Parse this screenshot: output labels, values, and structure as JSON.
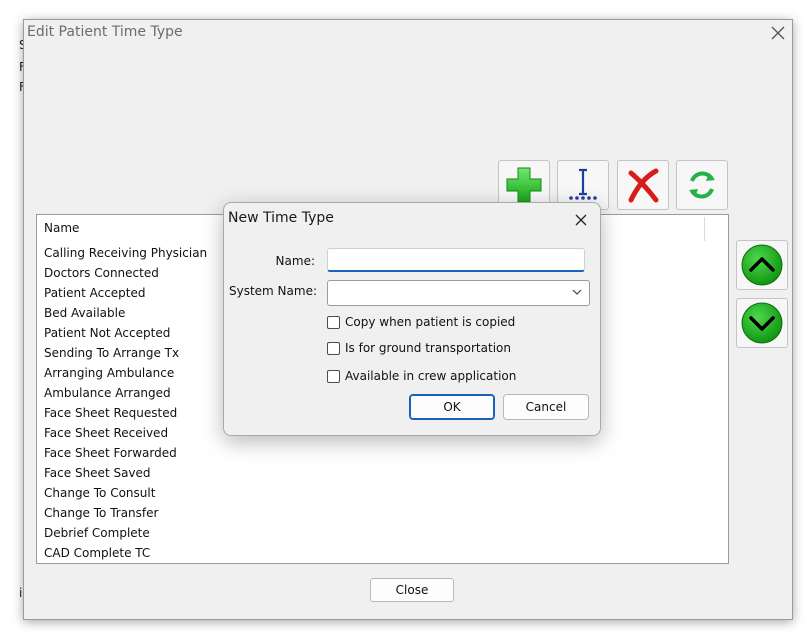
{
  "background": {
    "fragments": [
      "S",
      "F",
      "F",
      "i"
    ]
  },
  "main_window": {
    "title": "Edit Patient Time Type",
    "toolbar": {
      "add_icon": "plus-icon",
      "insert_icon": "insert-icon",
      "delete_icon": "delete-x-icon",
      "refresh_icon": "refresh-icon"
    },
    "list": {
      "header": "Name",
      "items": [
        "Calling Receiving Physician",
        "Doctors Connected",
        "Patient Accepted",
        "Bed Available",
        "Patient Not Accepted",
        "Sending To Arrange Tx",
        "Arranging Ambulance",
        "Ambulance Arranged",
        "Face Sheet Requested",
        "Face Sheet Received",
        "Face Sheet Forwarded",
        "Face Sheet Saved",
        "Change To Consult",
        "Change To Transfer",
        "Debrief Complete",
        "CAD Complete TC"
      ]
    },
    "close_label": "Close"
  },
  "dialog": {
    "title": "New Time Type",
    "name_label": "Name:",
    "name_value": "",
    "system_name_label": "System Name:",
    "system_name_value": "",
    "checkboxes": [
      {
        "label": "Copy when patient is copied",
        "checked": false
      },
      {
        "label": "Is for ground transportation",
        "checked": false
      },
      {
        "label": "Available in crew application",
        "checked": false
      }
    ],
    "ok_label": "OK",
    "cancel_label": "Cancel"
  },
  "colors": {
    "accent": "#1a62b5",
    "add_green": "#2fbf2f",
    "delete_red": "#d81b1b",
    "refresh_green": "#22b24c",
    "arrow_green": "#12a312",
    "insert_blue": "#1f3f9e"
  }
}
